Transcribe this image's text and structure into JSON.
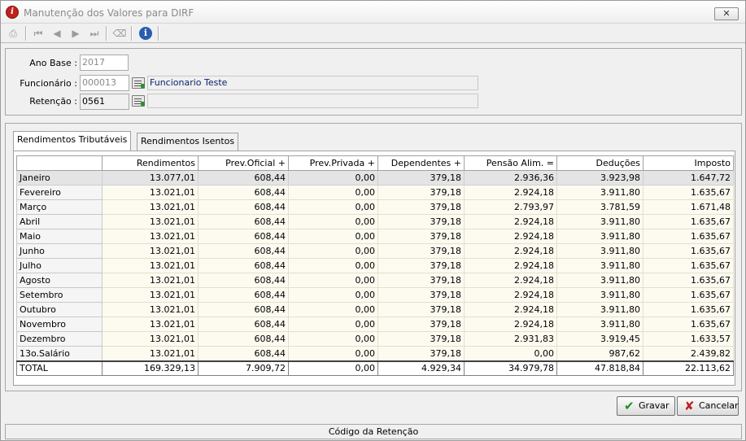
{
  "window": {
    "title": "Manutenção dos Valores para DIRF",
    "close_glyph": "✕"
  },
  "toolbar": {
    "icons": [
      "printer-icon",
      "first-record-icon",
      "previous-record-icon",
      "next-record-icon",
      "last-record-icon",
      "erase-icon",
      "info-icon"
    ],
    "info_glyph": "i"
  },
  "form": {
    "ano_base_label": "Ano Base :",
    "ano_base_value": "2017",
    "funcionario_label": "Funcionário :",
    "funcionario_code": "000013",
    "funcionario_name": "Funcionario Teste",
    "retencao_label": "Retenção :",
    "retencao_code": "0561",
    "retencao_desc": ""
  },
  "tabs": [
    {
      "label": "Rendimentos Tributáveis",
      "active": true
    },
    {
      "label": "Rendimentos Isentos",
      "active": false
    }
  ],
  "grid": {
    "columns": [
      "",
      "Rendimentos",
      "Prev.Oficial +",
      "Prev.Privada +",
      "Dependentes +",
      "Pensão Alim. =",
      "Deduções",
      "Imposto"
    ],
    "rows": [
      [
        "Janeiro",
        "13.077,01",
        "608,44",
        "0,00",
        "379,18",
        "2.936,36",
        "3.923,98",
        "1.647,72"
      ],
      [
        "Fevereiro",
        "13.021,01",
        "608,44",
        "0,00",
        "379,18",
        "2.924,18",
        "3.911,80",
        "1.635,67"
      ],
      [
        "Março",
        "13.021,01",
        "608,44",
        "0,00",
        "379,18",
        "2.793,97",
        "3.781,59",
        "1.671,48"
      ],
      [
        "Abril",
        "13.021,01",
        "608,44",
        "0,00",
        "379,18",
        "2.924,18",
        "3.911,80",
        "1.635,67"
      ],
      [
        "Maio",
        "13.021,01",
        "608,44",
        "0,00",
        "379,18",
        "2.924,18",
        "3.911,80",
        "1.635,67"
      ],
      [
        "Junho",
        "13.021,01",
        "608,44",
        "0,00",
        "379,18",
        "2.924,18",
        "3.911,80",
        "1.635,67"
      ],
      [
        "Julho",
        "13.021,01",
        "608,44",
        "0,00",
        "379,18",
        "2.924,18",
        "3.911,80",
        "1.635,67"
      ],
      [
        "Agosto",
        "13.021,01",
        "608,44",
        "0,00",
        "379,18",
        "2.924,18",
        "3.911,80",
        "1.635,67"
      ],
      [
        "Setembro",
        "13.021,01",
        "608,44",
        "0,00",
        "379,18",
        "2.924,18",
        "3.911,80",
        "1.635,67"
      ],
      [
        "Outubro",
        "13.021,01",
        "608,44",
        "0,00",
        "379,18",
        "2.924,18",
        "3.911,80",
        "1.635,67"
      ],
      [
        "Novembro",
        "13.021,01",
        "608,44",
        "0,00",
        "379,18",
        "2.924,18",
        "3.911,80",
        "1.635,67"
      ],
      [
        "Dezembro",
        "13.021,01",
        "608,44",
        "0,00",
        "379,18",
        "2.931,83",
        "3.919,45",
        "1.633,57"
      ],
      [
        "13o.Salário",
        "13.021,01",
        "608,44",
        "0,00",
        "379,18",
        "0,00",
        "987,62",
        "2.439,82"
      ]
    ],
    "total": [
      "TOTAL",
      "169.329,13",
      "7.909,72",
      "0,00",
      "4.929,34",
      "34.979,78",
      "47.818,84",
      "22.113,62"
    ]
  },
  "buttons": {
    "save_label": "Gravar",
    "save_glyph": "✔",
    "cancel_label": "Cancelar",
    "cancel_glyph": "✘"
  },
  "colors": {
    "save_icon": "#1f8f1f",
    "cancel_icon": "#c02020"
  },
  "status": {
    "text": "Código da Retenção"
  }
}
